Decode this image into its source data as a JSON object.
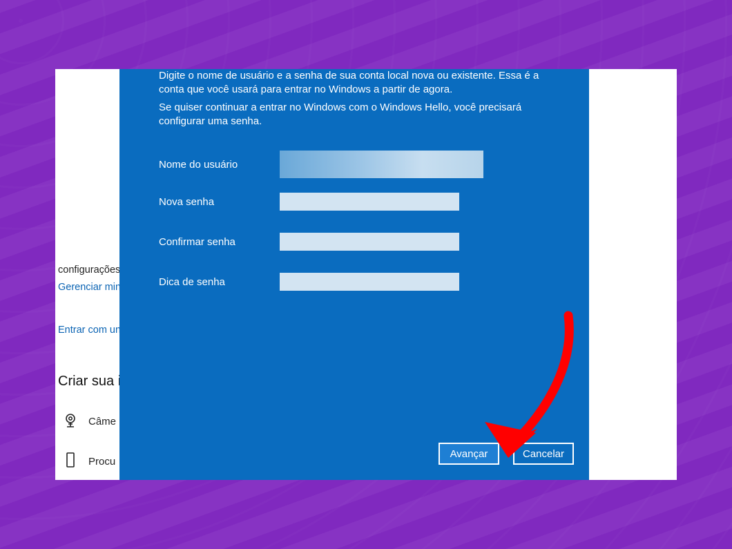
{
  "colors": {
    "wallpaper": "#8733C3",
    "dialog_bg": "#0a6cbf",
    "field_bg": "#d3e4f2",
    "link": "#0a63b3",
    "annotation": "#ff0000"
  },
  "background": {
    "config_label": "configurações",
    "link_manage": "Gerenciar min",
    "link_signin_local": "Entrar com un",
    "section_title": "Criar sua i",
    "option_camera": "Câme",
    "option_browse": "Procu"
  },
  "dialog": {
    "paragraph1": "Digite o nome de usuário e a senha de sua conta local nova ou existente. Essa é a conta que você usará para entrar no Windows a partir de agora.",
    "paragraph2": "Se quiser continuar a entrar no Windows com o Windows Hello, você precisará configurar uma senha.",
    "labels": {
      "username": "Nome do usuário",
      "new_password": "Nova senha",
      "confirm_password": "Confirmar senha",
      "password_hint": "Dica de senha"
    },
    "values": {
      "username": "",
      "new_password": "",
      "confirm_password": "",
      "password_hint": ""
    },
    "buttons": {
      "next": "Avançar",
      "cancel": "Cancelar"
    }
  }
}
